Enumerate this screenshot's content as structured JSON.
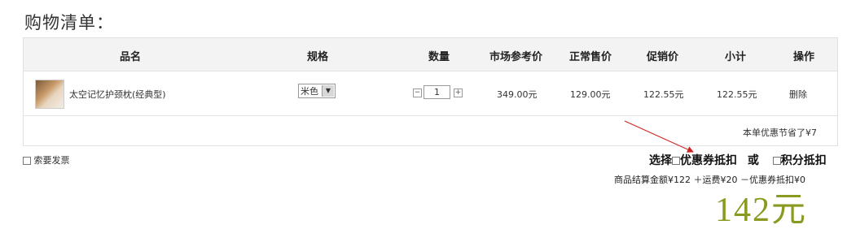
{
  "page": {
    "title": "购物清单："
  },
  "table": {
    "headers": {
      "name": "品名",
      "spec": "规格",
      "qty": "数量",
      "market": "市场参考价",
      "normal": "正常售价",
      "promo": "促销价",
      "subtotal": "小计",
      "action": "操作"
    },
    "item": {
      "name": "太空记忆护颈枕(经典型)",
      "spec": "米色",
      "qty": "1",
      "qty_minus": "−",
      "qty_plus": "+",
      "market_price": "349.00元",
      "normal_price": "129.00元",
      "promo_price": "122.55元",
      "subtotal": "122.55元",
      "delete": "删除"
    },
    "savings": "本单优惠节省了¥7"
  },
  "invoice": {
    "label": "索要发票"
  },
  "options": {
    "choose": "选择",
    "coupon": "优惠券抵扣",
    "or": "或",
    "points": "积分抵扣"
  },
  "summary": {
    "text": "商品结算金额¥122 ＋运费¥20 －优惠券抵扣¥0"
  },
  "total": {
    "value": "142元"
  },
  "colors": {
    "arrow": "#cc2222",
    "total": "#8a9a20"
  }
}
